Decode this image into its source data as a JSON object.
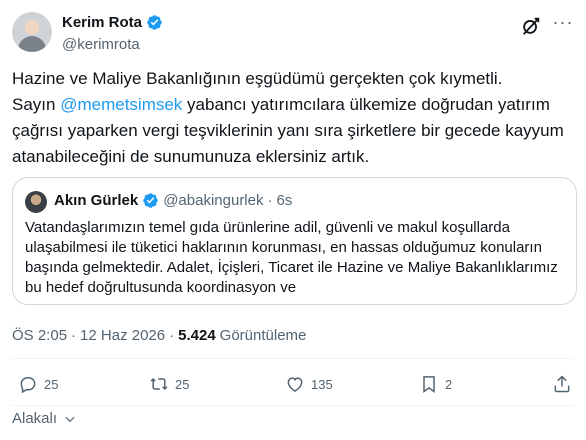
{
  "author": {
    "display_name": "Kerim Rota",
    "handle": "@kerimrota"
  },
  "tweet": {
    "line1": "Hazine ve Maliye Bakanlığının eşgüdümü gerçekten çok kıymetli.",
    "line2_pre": " Sayın ",
    "mention": "@memetsimsek",
    "line2_post": " yabancı yatırımcılara ülkemize doğrudan yatırım çağrısı yaparken vergi teşviklerinin yanı sıra şirketlere bir gecede kayyum atanabileceğini de sunumunuza eklersiniz artık."
  },
  "quote": {
    "display_name": "Akın Gürlek",
    "handle": "@abakingurlek",
    "separator": "·",
    "time": "6s",
    "text": "Vatandaşlarımızın temel gıda ürünlerine adil, güvenli ve makul koşullarda ulaşabilmesi ile tüketici haklarının korunması, en hassas olduğumuz konuların başında gelmektedir. Adalet, İçişleri, Ticaret ile Hazine ve Maliye Bakanlıklarımız bu hedef doğrultusunda koordinasyon ve"
  },
  "meta": {
    "time": "ÖS 2:05",
    "separator": "·",
    "date": "12 Haz 2026",
    "views_count": "5.424",
    "views_label": "Görüntüleme"
  },
  "actions": {
    "replies": "25",
    "reposts": "25",
    "likes": "135",
    "bookmarks": "2"
  },
  "replies_sort": {
    "label": "Alakalı"
  },
  "colors": {
    "accent": "#1d9bf0",
    "secondary_text": "#536471",
    "border": "#cfd9de"
  },
  "icons": [
    "verified-badge-icon",
    "grok-icon",
    "more-icon",
    "reply-icon",
    "repost-icon",
    "like-icon",
    "bookmark-icon",
    "share-icon",
    "chevron-down-icon"
  ]
}
